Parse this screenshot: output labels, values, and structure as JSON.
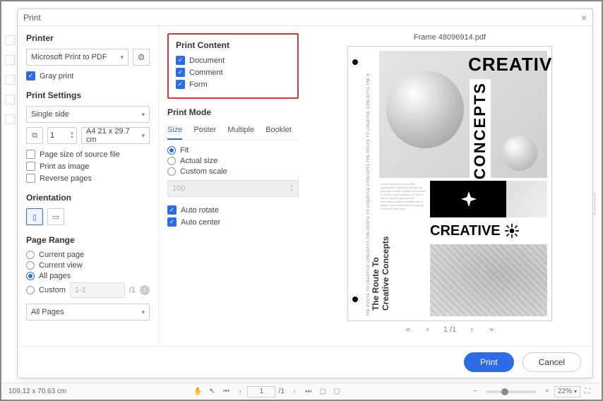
{
  "window": {
    "title": "Print"
  },
  "printer": {
    "heading": "Printer",
    "selected": "Microsoft Print to PDF",
    "gray_print": "Gray print"
  },
  "print_settings": {
    "heading": "Print Settings",
    "duplex": "Single side",
    "copies": "1",
    "paper": "A4 21 x 29.7 cm",
    "page_size_source": "Page size of source file",
    "print_as_image": "Print as image",
    "reverse_pages": "Reverse pages"
  },
  "orientation": {
    "heading": "Orientation"
  },
  "page_range": {
    "heading": "Page Range",
    "current_page": "Current page",
    "current_view": "Current view",
    "all_pages": "All pages",
    "custom": "Custom",
    "custom_placeholder": "1-1",
    "custom_total": "/1",
    "filter": "All Pages"
  },
  "print_content": {
    "heading": "Print Content",
    "document": "Document",
    "comment": "Comment",
    "form": "Form"
  },
  "print_mode": {
    "heading": "Print Mode",
    "tabs": {
      "size": "Size",
      "poster": "Poster",
      "multiple": "Multiple",
      "booklet": "Booklet"
    },
    "fit": "Fit",
    "actual": "Actual size",
    "custom_scale": "Custom scale",
    "scale_value": "100",
    "auto_rotate": "Auto rotate",
    "auto_center": "Auto center"
  },
  "preview": {
    "filename": "Frame 48096914.pdf",
    "pagepos": "1 /1",
    "art": {
      "creative": "CREATIVE",
      "concepts": "CONCEPTS",
      "route": "The Route To",
      "route2": "Creative Concepts",
      "sidetext": "THE ROUTE TO CREATIVE CONCEPTS THE ROUTE TO CREATIVE CONCEPTS THE ROUTE TO CREATIVE CONCEPTS THE R"
    }
  },
  "buttons": {
    "print": "Print",
    "cancel": "Cancel"
  },
  "statusbar": {
    "dimensions": "109.12 x 70.63 cm",
    "page": "1",
    "pagetotal": "/1",
    "zoom": "22%"
  }
}
